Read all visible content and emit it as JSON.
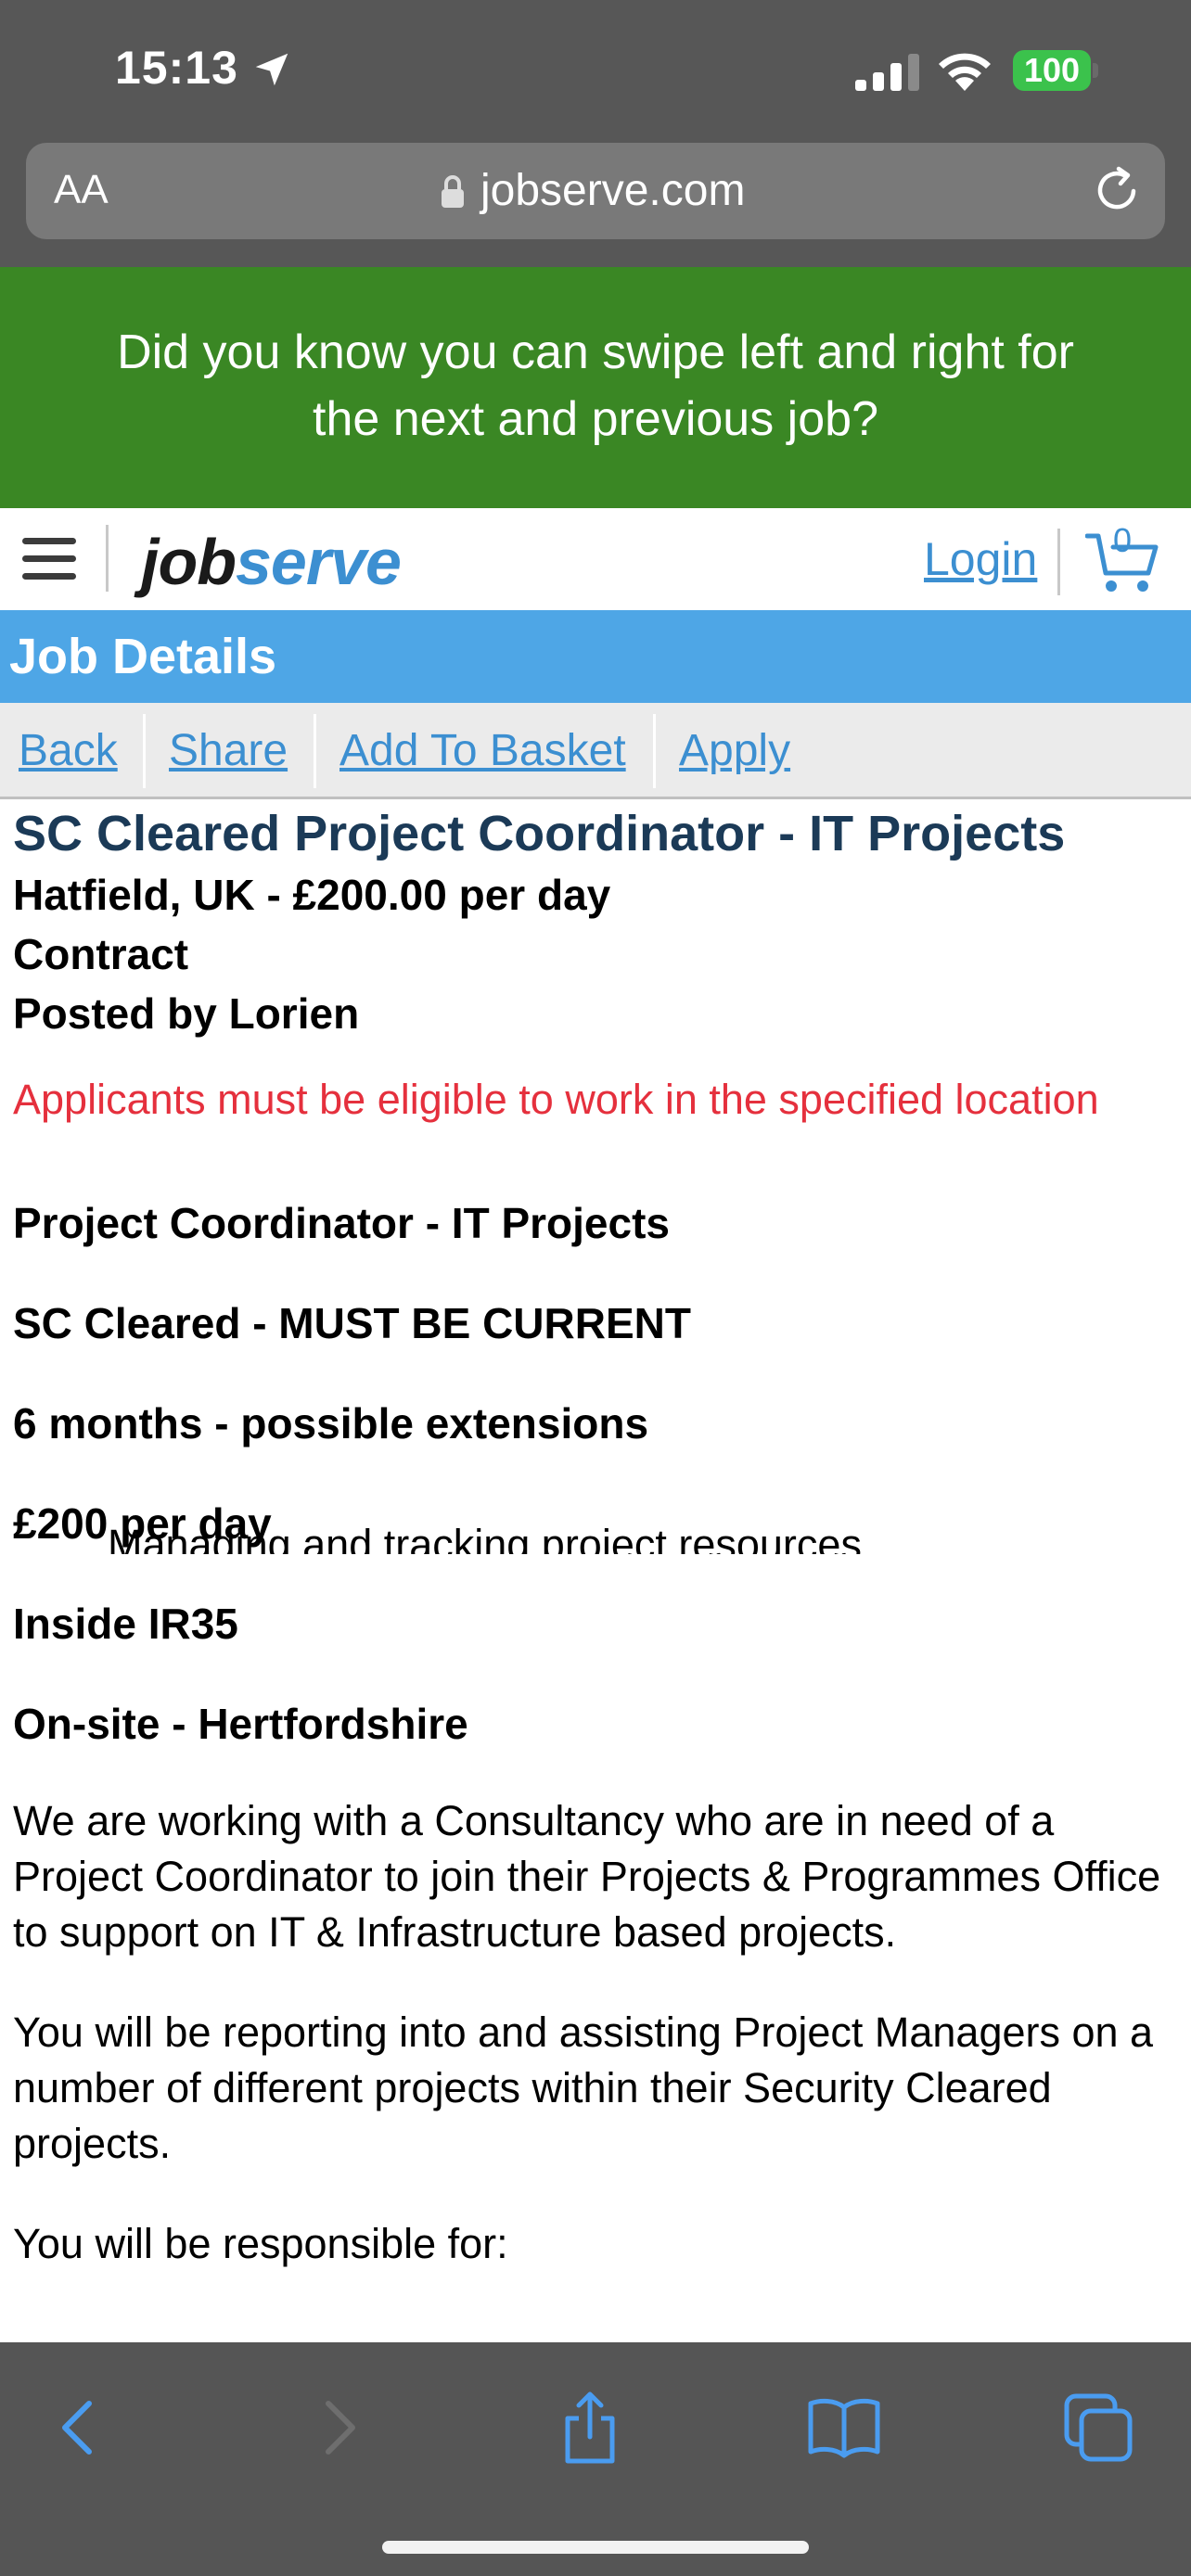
{
  "status_bar": {
    "time": "15:13",
    "battery": "100"
  },
  "browser": {
    "aa_label": "AA",
    "url": "jobserve.com"
  },
  "banner": {
    "line1": "Did you know you can swipe left and right for",
    "line2": "the next and previous job?"
  },
  "header": {
    "logo_job": "job",
    "logo_serve": "serve",
    "login": "Login",
    "cart_count": "0"
  },
  "section": {
    "title": "Job Details"
  },
  "actions": [
    "Back",
    "Share",
    "Add To Basket",
    "Apply"
  ],
  "job": {
    "title": "SC Cleared Project Coordinator - IT Projects",
    "location_rate": "Hatfield, UK - £200.00 per day",
    "type": "Contract",
    "posted_by": "Posted by Lorien",
    "warning": "Applicants must be eligible to work in the specified location",
    "highlights": [
      "Project Coordinator - IT Projects",
      "SC Cleared - MUST BE CURRENT",
      "6 months - possible extensions",
      "£200 per day",
      "Inside IR35",
      "On-site - Hertfordshire"
    ],
    "paragraphs": [
      "We are working with a Consultancy who are in need of a Project Coordinator to join their Projects & Programmes Office to support on IT & Infrastructure based projects.",
      "You will be reporting into and assisting Project Managers on a number of different projects within their Security Cleared projects.",
      "You will be responsible for:"
    ],
    "bullets": [
      "Managing and tracking project resources"
    ]
  },
  "colors": {
    "banner_green": "#3a8724",
    "section_blue": "#4ea6e6",
    "link_blue": "#3c8fd1",
    "title_navy": "#1b3a57",
    "warning_red": "#e5303d",
    "chrome_gray": "#575757"
  },
  "icons": {
    "status": [
      "location-arrow-icon",
      "signal-icon",
      "wifi-icon",
      "battery-icon"
    ],
    "browser": [
      "lock-icon",
      "reload-icon"
    ],
    "header": [
      "hamburger-menu-icon",
      "cart-icon"
    ],
    "toolbar": [
      "back-arrow-icon",
      "forward-arrow-icon",
      "share-icon",
      "bookmarks-icon",
      "tabs-icon"
    ]
  }
}
